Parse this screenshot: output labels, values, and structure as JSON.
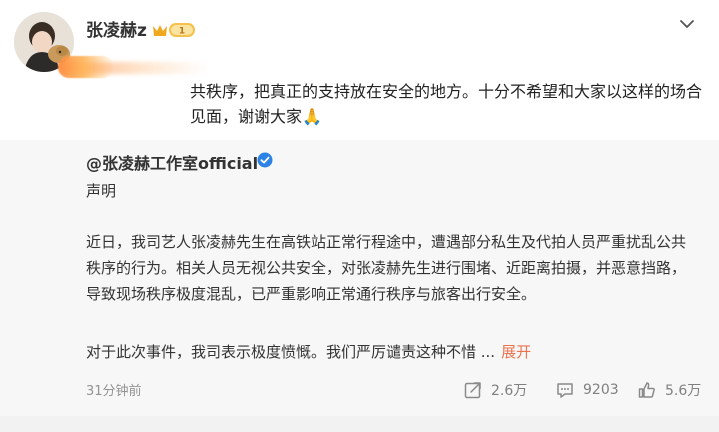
{
  "post": {
    "author": "张凌赫z",
    "vip_level": "1",
    "text": "共秩序，把真正的支持放在安全的地方。十分不希望和大家以这样的场合见面，谢谢大家🙏"
  },
  "repost": {
    "author": "@张凌赫工作室official",
    "title": "声明",
    "paragraph1": "近日，我司艺人张凌赫先生在高铁站正常行程途中，遭遇部分私生及代拍人员严重扰乱公共秩序的行为。相关人员无视公共安全，对张凌赫先生进行围堵、近距离拍摄，并恶意挡路，导致现场秩序极度混乱，已严重影响正常通行秩序与旅客出行安全。",
    "paragraph2": "对于此次事件，我司表示极度愤慨。我们严厉谴责这种不惜 ...",
    "expand_label": "展开",
    "time": "31分钟前",
    "shares": "2.6万",
    "comments": "9203",
    "likes": "5.6万"
  },
  "colors": {
    "accent": "#eb7350",
    "verified": "#2d82e6",
    "vip_gold": "#f0a81f"
  },
  "icons": {
    "chevron": "chevron-down-icon",
    "share": "share-icon",
    "comment": "comment-icon",
    "like": "like-icon",
    "verified": "verified-icon",
    "vip": "vip-crown-icon"
  }
}
